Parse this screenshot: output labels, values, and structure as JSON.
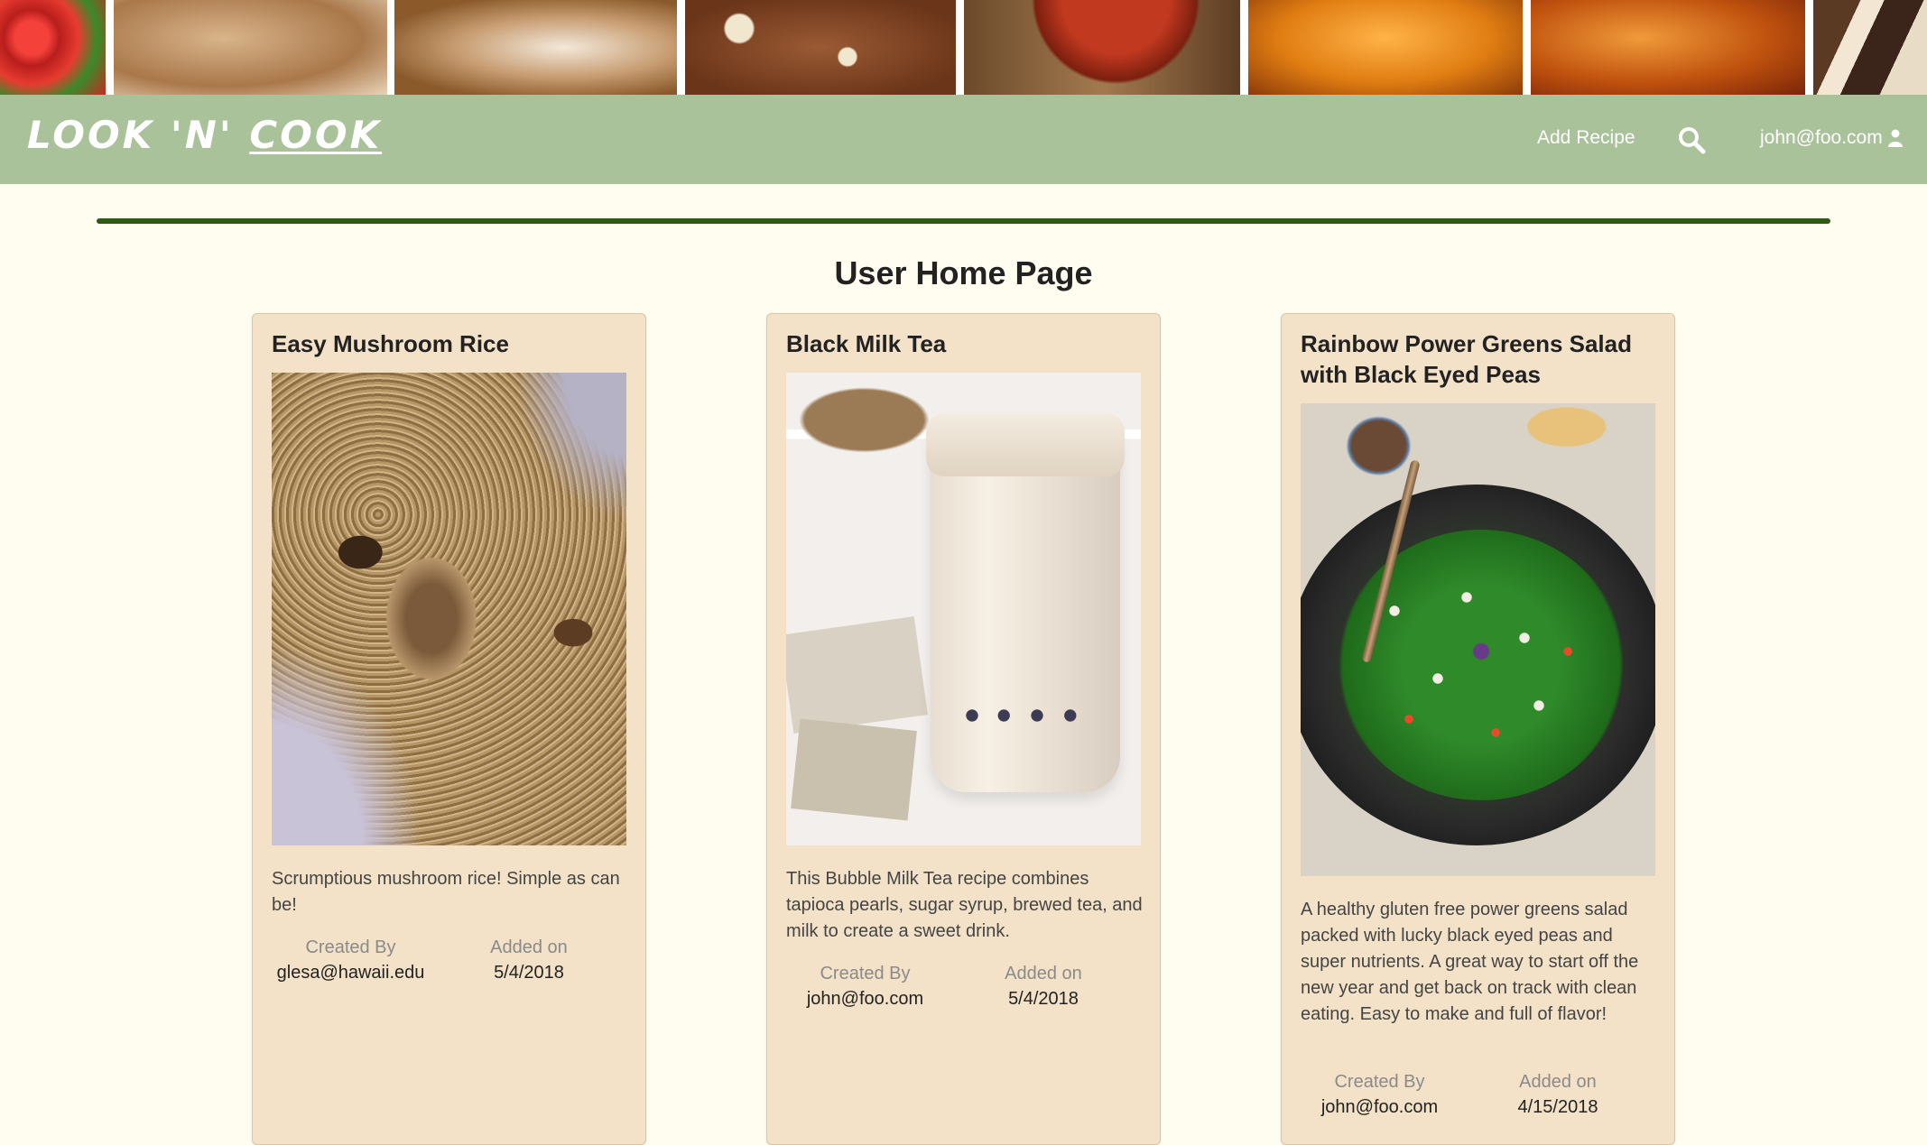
{
  "app": {
    "logo_part1": "LOOK ",
    "logo_part2": "'N' ",
    "logo_part3": "COOK"
  },
  "nav": {
    "add_recipe": "Add Recipe",
    "search_icon": "search-icon",
    "user_email": "john@foo.com",
    "user_icon": "user-icon"
  },
  "page": {
    "title": "User Home Page"
  },
  "colors": {
    "navbar": "#a9c299",
    "page_bg": "#fefdf0",
    "card_bg": "#f3e2c8",
    "divider": "#2e5a16"
  },
  "recipes": [
    {
      "title": "Easy Mushroom Rice",
      "description": "Scrumptious mushroom rice! Simple as can be!",
      "created_by_label": "Created By",
      "created_by": "glesa@hawaii.edu",
      "added_on_label": "Added on",
      "added_on": "5/4/2018"
    },
    {
      "title": "Black Milk Tea",
      "description": "This Bubble Milk Tea recipe combines tapioca pearls, sugar syrup, brewed tea, and milk to create a sweet drink.",
      "created_by_label": "Created By",
      "created_by": "john@foo.com",
      "added_on_label": "Added on",
      "added_on": "5/4/2018"
    },
    {
      "title": "Rainbow Power Greens Salad with Black Eyed Peas",
      "description": "A healthy gluten free power greens salad packed with lucky black eyed peas and super nutrients. A great way to start off the new year and get back on track with clean eating. Easy to make and full of flavor!",
      "created_by_label": "Created By",
      "created_by": "john@foo.com",
      "added_on_label": "Added on",
      "added_on": "4/15/2018"
    }
  ]
}
